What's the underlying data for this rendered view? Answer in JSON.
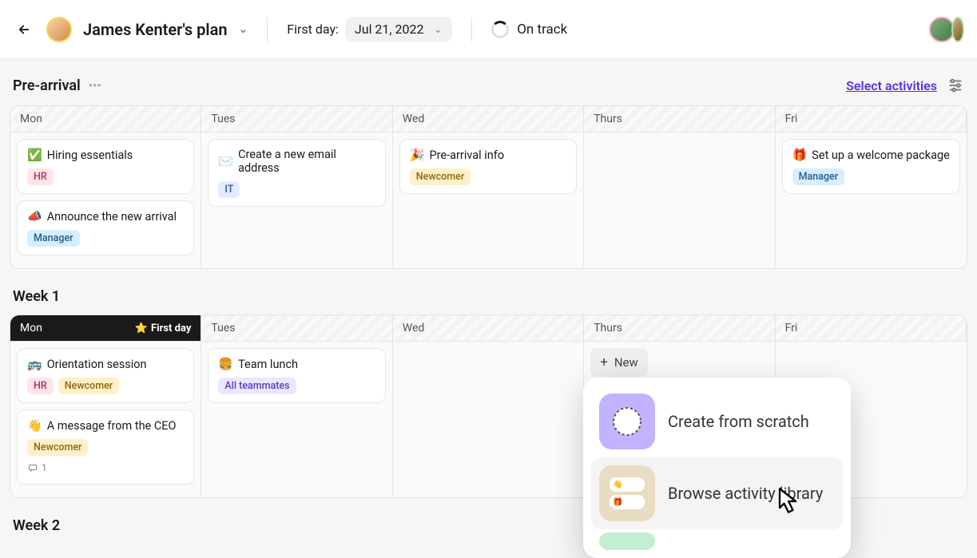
{
  "header": {
    "plan_title": "James Kenter's plan",
    "first_day_label": "First day:",
    "first_day_value": "Jul 21, 2022",
    "status": "On track"
  },
  "sections": {
    "prearrival": {
      "title": "Pre-arrival",
      "select_activities": "Select activities",
      "days": [
        "Mon",
        "Tues",
        "Wed",
        "Thurs",
        "Fri"
      ],
      "cards": {
        "mon": [
          {
            "emoji": "✅",
            "title": "Hiring essentials",
            "tags": [
              {
                "label": "HR",
                "cls": "tag-hr"
              }
            ]
          },
          {
            "emoji": "📣",
            "title": "Announce the new arrival",
            "tags": [
              {
                "label": "Manager",
                "cls": "tag-manager"
              }
            ]
          }
        ],
        "tues": [
          {
            "emoji": "✉️",
            "title": "Create a new email address",
            "tags": [
              {
                "label": "IT",
                "cls": "tag-it"
              }
            ]
          }
        ],
        "wed": [
          {
            "emoji": "🎉",
            "title": "Pre-arrival info",
            "tags": [
              {
                "label": "Newcomer",
                "cls": "tag-newcomer"
              }
            ]
          }
        ],
        "fri": [
          {
            "emoji": "🎁",
            "title": "Set up a welcome package",
            "tags": [
              {
                "label": "Manager",
                "cls": "tag-manager"
              }
            ]
          }
        ]
      }
    },
    "week1": {
      "title": "Week 1",
      "days": [
        "Mon",
        "Tues",
        "Wed",
        "Thurs",
        "Fri"
      ],
      "first_day_badge": "First day",
      "cards": {
        "mon": [
          {
            "emoji": "🚌",
            "title": "Orientation session",
            "tags": [
              {
                "label": "HR",
                "cls": "tag-hr"
              },
              {
                "label": "Newcomer",
                "cls": "tag-newcomer"
              }
            ]
          },
          {
            "emoji": "👋",
            "title": "A message from the CEO",
            "tags": [
              {
                "label": "Newcomer",
                "cls": "tag-newcomer"
              }
            ],
            "comments": "1"
          }
        ],
        "tues": [
          {
            "emoji": "🍔",
            "title": "Team lunch",
            "tags": [
              {
                "label": "All teammates",
                "cls": "tag-all"
              }
            ]
          }
        ],
        "thurs_new": "New"
      }
    },
    "week2": {
      "title": "Week 2"
    }
  },
  "popup": {
    "create": "Create from scratch",
    "browse": "Browse activity library"
  }
}
